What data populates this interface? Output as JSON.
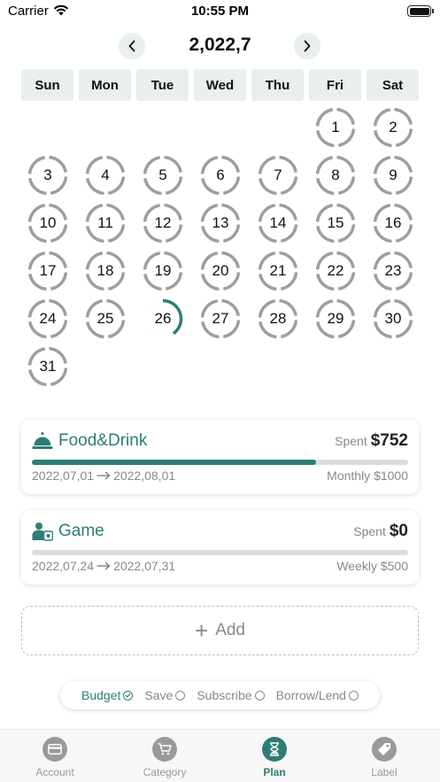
{
  "status_bar": {
    "carrier": "Carrier",
    "time": "10:55 PM"
  },
  "header": {
    "month": "2,022,7"
  },
  "weekdays": [
    "Sun",
    "Mon",
    "Tue",
    "Wed",
    "Thu",
    "Fri",
    "Sat"
  ],
  "calendar": {
    "first_weekday_index": 5,
    "days": [
      {
        "day": "1",
        "progress": 0
      },
      {
        "day": "2",
        "progress": 0
      },
      {
        "day": "3",
        "progress": 0
      },
      {
        "day": "4",
        "progress": 0
      },
      {
        "day": "5",
        "progress": 0
      },
      {
        "day": "6",
        "progress": 0
      },
      {
        "day": "7",
        "progress": 0
      },
      {
        "day": "8",
        "progress": 0
      },
      {
        "day": "9",
        "progress": 0
      },
      {
        "day": "10",
        "progress": 0
      },
      {
        "day": "11",
        "progress": 0
      },
      {
        "day": "12",
        "progress": 0
      },
      {
        "day": "13",
        "progress": 0
      },
      {
        "day": "14",
        "progress": 0
      },
      {
        "day": "15",
        "progress": 0
      },
      {
        "day": "16",
        "progress": 0
      },
      {
        "day": "17",
        "progress": 0
      },
      {
        "day": "18",
        "progress": 0
      },
      {
        "day": "19",
        "progress": 0
      },
      {
        "day": "20",
        "progress": 0
      },
      {
        "day": "21",
        "progress": 0
      },
      {
        "day": "22",
        "progress": 0
      },
      {
        "day": "23",
        "progress": 0
      },
      {
        "day": "24",
        "progress": 0
      },
      {
        "day": "25",
        "progress": 0
      },
      {
        "day": "26",
        "progress": 0.4
      },
      {
        "day": "27",
        "progress": 0
      },
      {
        "day": "28",
        "progress": 0
      },
      {
        "day": "29",
        "progress": 0
      },
      {
        "day": "30",
        "progress": 0
      },
      {
        "day": "31",
        "progress": 0
      }
    ]
  },
  "budgets": [
    {
      "icon": "food-cloche-icon",
      "name": "Food&Drink",
      "spent_label": "Spent",
      "spent": "$752",
      "progress": 0.755,
      "start": "2022,07,01",
      "end": "2022,08,01",
      "limit": "Monthly $1000"
    },
    {
      "icon": "game-people-icon",
      "name": "Game",
      "spent_label": "Spent",
      "spent": "$0",
      "progress": 0,
      "start": "2022,07,24",
      "end": "2022,07,31",
      "limit": "Weekly $500"
    }
  ],
  "add_button": {
    "label": "Add"
  },
  "segment": {
    "items": [
      {
        "label": "Budget",
        "selected": true
      },
      {
        "label": "Save",
        "selected": false
      },
      {
        "label": "Subscribe",
        "selected": false
      },
      {
        "label": "Borrow/Lend",
        "selected": false
      }
    ]
  },
  "tabbar": {
    "tabs": [
      {
        "label": "Account",
        "icon": "wallet-icon",
        "active": false
      },
      {
        "label": "Category",
        "icon": "cart-icon",
        "active": false
      },
      {
        "label": "Plan",
        "icon": "hourglass-icon",
        "active": true
      },
      {
        "label": "Label",
        "icon": "tag-icon",
        "active": false
      }
    ]
  },
  "colors": {
    "accent": "#2e7d74",
    "ring": "#9e9e9e",
    "muted_text": "#888888",
    "chip_bg": "#e9eeee"
  }
}
